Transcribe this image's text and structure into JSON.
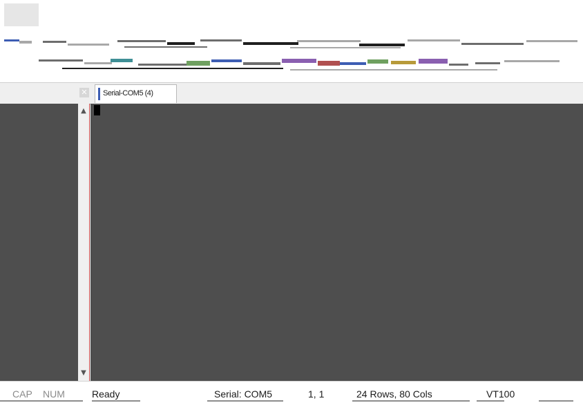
{
  "tabs": [
    {
      "label": "Serial-COM5 (4)"
    }
  ],
  "icons": {
    "tab_close": "close-icon",
    "scroll_up": "chevron-up-icon",
    "scroll_down": "chevron-down-icon"
  },
  "statusbar": {
    "cap": "CAP",
    "num": "NUM",
    "state": "Ready",
    "session": "Serial: COM5",
    "cursor_position": "1,  1",
    "size": "24 Rows, 80 Cols",
    "terminal_type": "VT100"
  },
  "colors": {
    "terminal_background": "#4e4e4e",
    "cursor": "#000000",
    "tab_accent": "#3d5db3"
  }
}
